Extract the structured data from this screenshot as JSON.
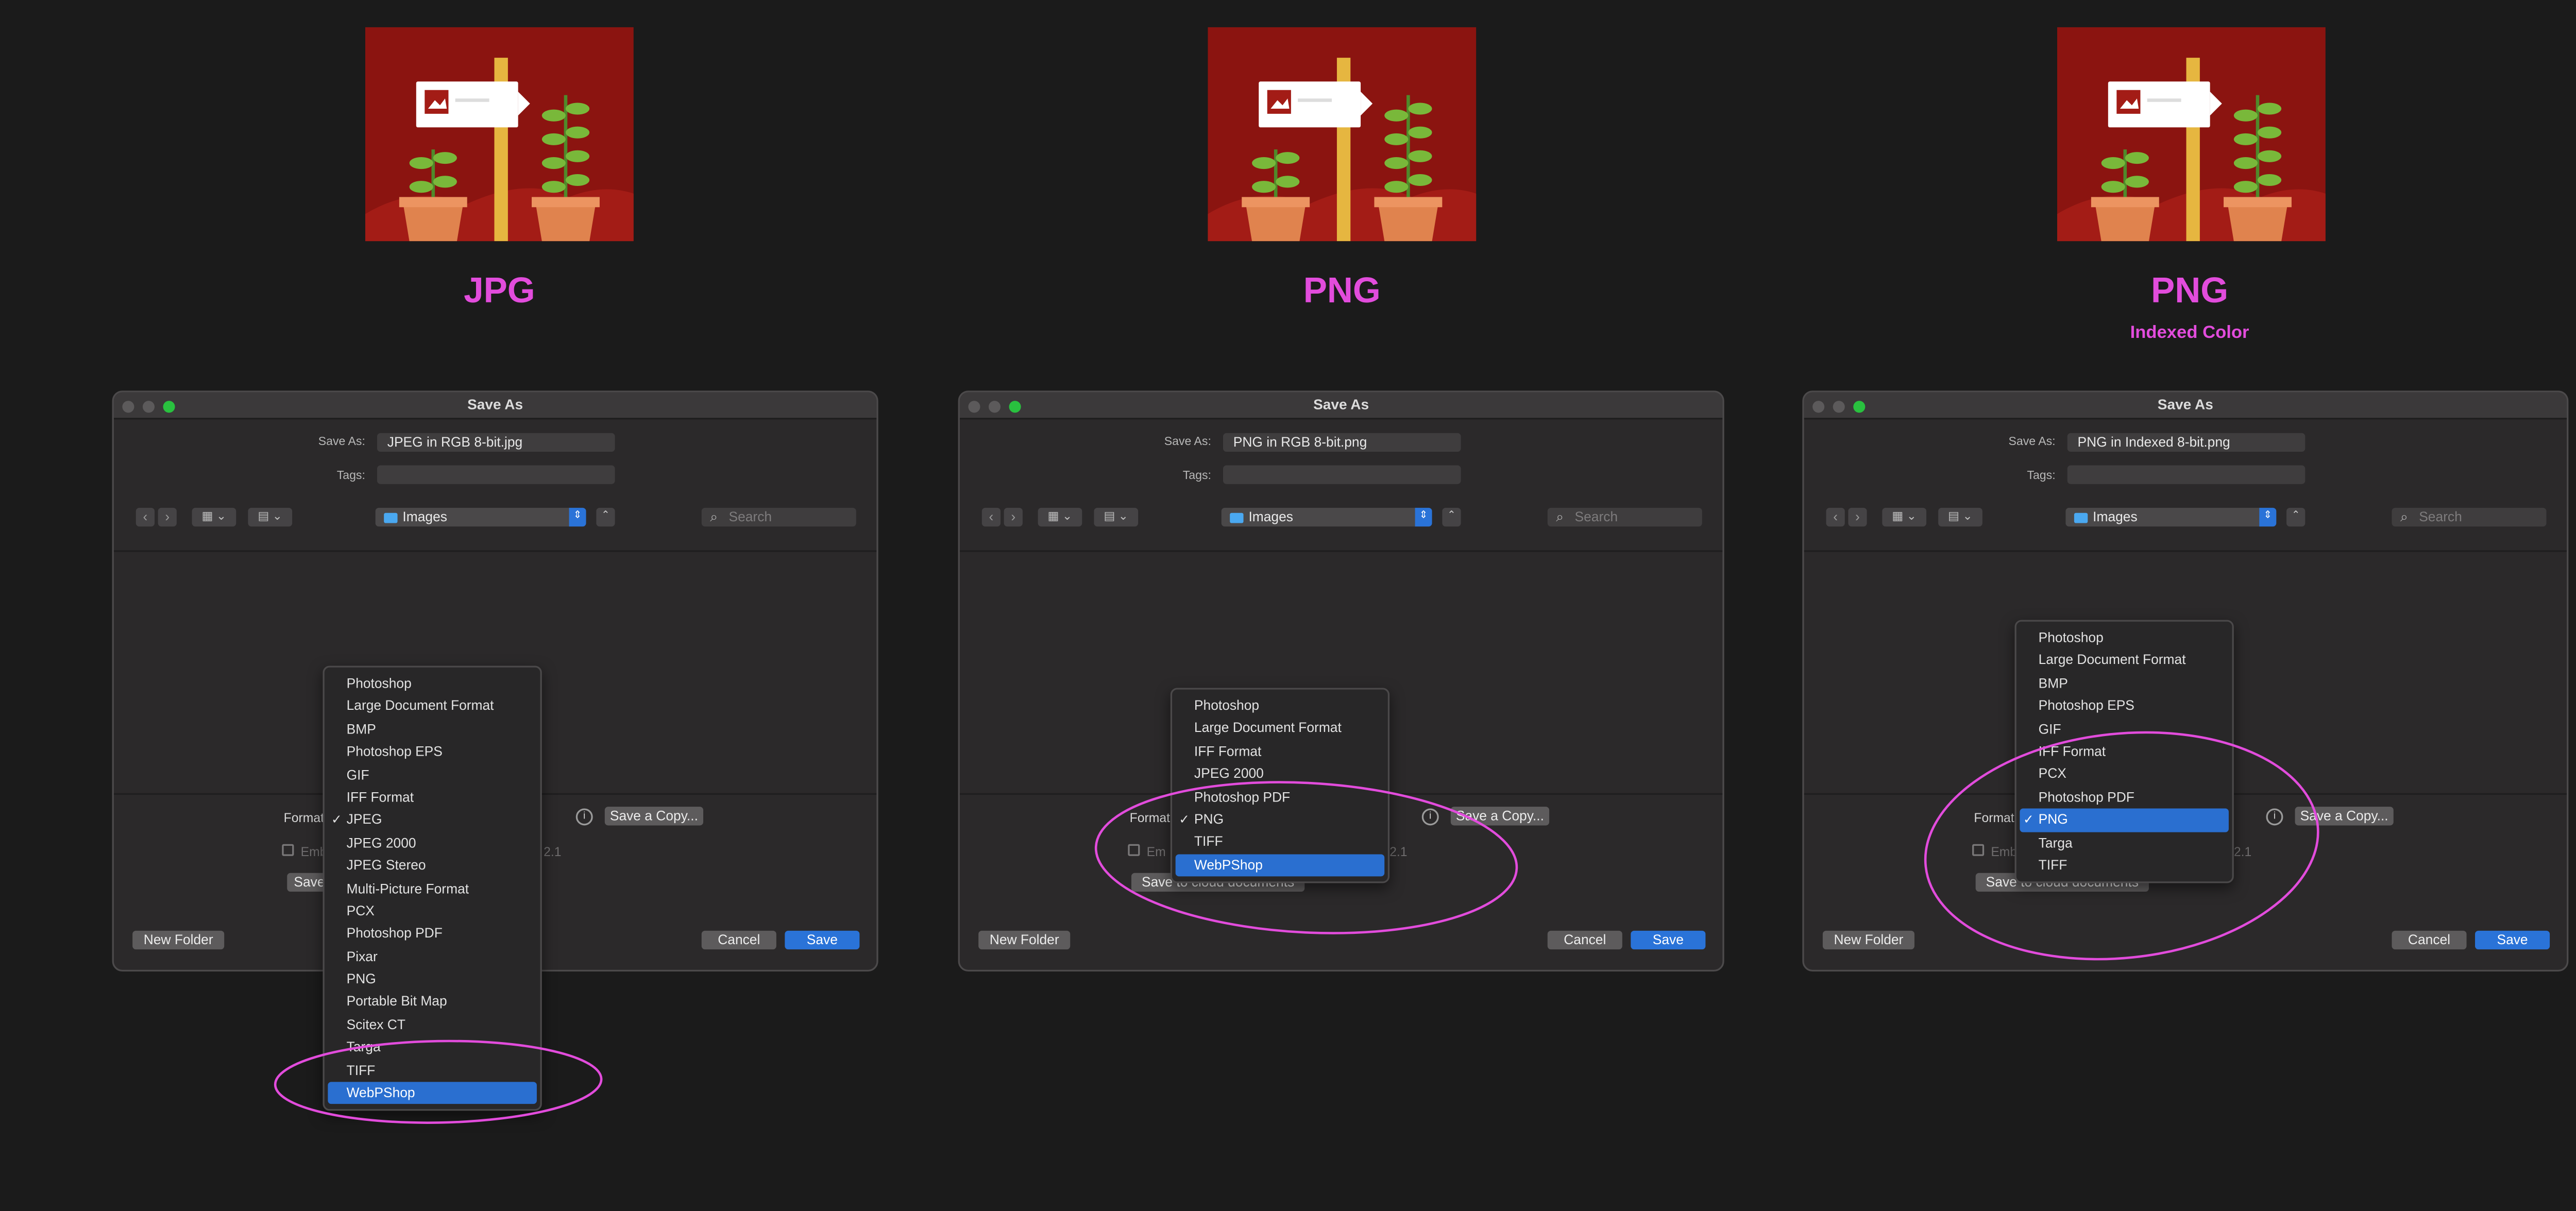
{
  "colors": {
    "annotation": "#e24cdc",
    "accent": "#2a73d8",
    "art_bg": "#8b1410"
  },
  "panels": [
    {
      "format_title": "JPG",
      "format_subtitle": "",
      "dialog": {
        "title": "Save As",
        "save_as_label": "Save As:",
        "save_as_value": "JPEG in RGB 8-bit.jpg",
        "tags_label": "Tags:",
        "location": "Images",
        "search_placeholder": "Search",
        "format_label": "Format",
        "save_copy_label": "Save a Copy...",
        "embed_partial": "Emb",
        "profile_suffix": "2.1",
        "cloud_partial": "Save",
        "new_folder": "New Folder",
        "cancel": "Cancel",
        "save": "Save"
      },
      "menu": {
        "items": [
          "Photoshop",
          "Large Document Format",
          "BMP",
          "Photoshop EPS",
          "GIF",
          "IFF Format",
          "JPEG",
          "JPEG 2000",
          "JPEG Stereo",
          "Multi-Picture Format",
          "PCX",
          "Photoshop PDF",
          "Pixar",
          "PNG",
          "Portable Bit Map",
          "Scitex CT",
          "Targa",
          "TIFF",
          "WebPShop"
        ],
        "checked": "JPEG",
        "highlighted": "WebPShop"
      }
    },
    {
      "format_title": "PNG",
      "format_subtitle": "",
      "dialog": {
        "title": "Save As",
        "save_as_label": "Save As:",
        "save_as_value": "PNG in RGB 8-bit.png",
        "tags_label": "Tags:",
        "location": "Images",
        "search_placeholder": "Search",
        "format_label": "Format",
        "save_copy_label": "Save a Copy...",
        "embed_partial": "Em",
        "profile_suffix": "2.1",
        "cloud_label": "Save to cloud documents",
        "new_folder": "New Folder",
        "cancel": "Cancel",
        "save": "Save"
      },
      "menu": {
        "items": [
          "Photoshop",
          "Large Document Format",
          "IFF Format",
          "JPEG 2000",
          "Photoshop PDF",
          "PNG",
          "TIFF",
          "WebPShop"
        ],
        "checked": "PNG",
        "highlighted": "WebPShop"
      }
    },
    {
      "format_title": "PNG",
      "format_subtitle": "Indexed Color",
      "dialog": {
        "title": "Save As",
        "save_as_label": "Save As:",
        "save_as_value": "PNG in Indexed 8-bit.png",
        "tags_label": "Tags:",
        "location": "Images",
        "search_placeholder": "Search",
        "format_label": "Format",
        "save_copy_label": "Save a Copy...",
        "embed_partial": "Emb",
        "profile_suffix": "2.1",
        "cloud_label": "Save to cloud documents",
        "new_folder": "New Folder",
        "cancel": "Cancel",
        "save": "Save"
      },
      "menu": {
        "items": [
          "Photoshop",
          "Large Document Format",
          "BMP",
          "Photoshop EPS",
          "GIF",
          "IFF Format",
          "PCX",
          "Photoshop PDF",
          "PNG",
          "Targa",
          "TIFF"
        ],
        "checked": "PNG",
        "highlighted": "PNG"
      }
    }
  ]
}
